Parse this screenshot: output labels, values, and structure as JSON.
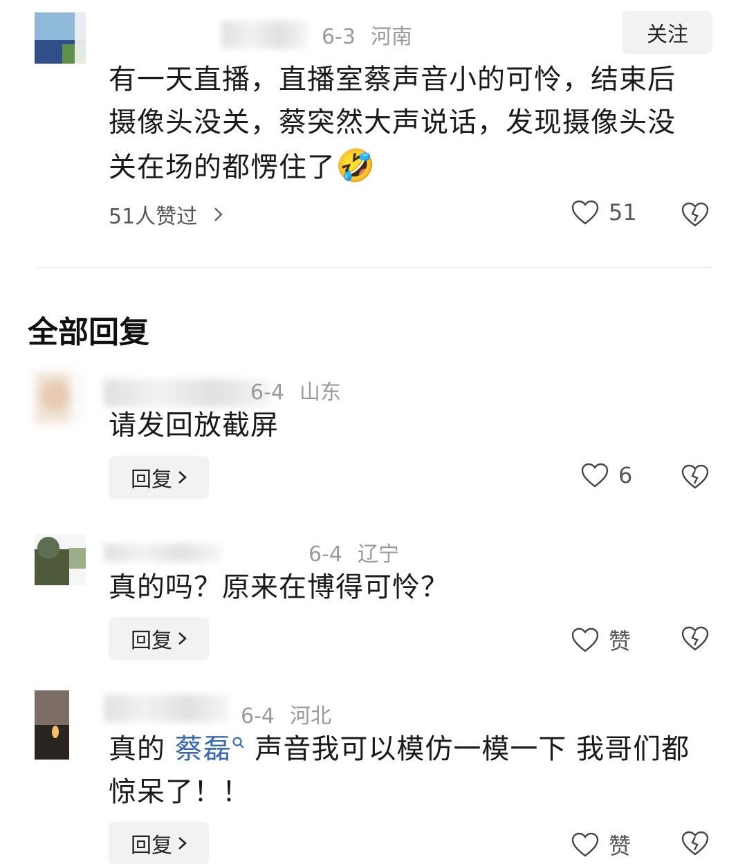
{
  "main_comment": {
    "date": "6-3",
    "location": "河南",
    "follow_label": "关注",
    "text": "有一天直播，直播室蔡声音小的可怜，结束后摄像头没关，蔡突然大声说话，发现摄像头没关在场的都愣住了",
    "emoji": "🤣",
    "likers_text": "51人赞过",
    "like_count": "51"
  },
  "replies_title": "全部回复",
  "replies": [
    {
      "date": "6-4",
      "location": "山东",
      "text": "请发回放截屏",
      "reply_label": "回复",
      "like_label": "6"
    },
    {
      "date": "6-4",
      "location": "辽宁",
      "text": "真的吗？原来在博得可怜？",
      "reply_label": "回复",
      "like_label": "赞"
    },
    {
      "date": "6-4",
      "location": "河北",
      "text_prefix": "真的 ",
      "mention": "蔡磊",
      "text_suffix": " 声音我可以模仿一模一下 我哥们都惊呆了！！",
      "reply_label": "回复",
      "like_label": "赞"
    }
  ],
  "colors": {
    "link": "#3a6bb0",
    "meta": "#9a9a9a",
    "button_bg": "#f2f2f2"
  }
}
